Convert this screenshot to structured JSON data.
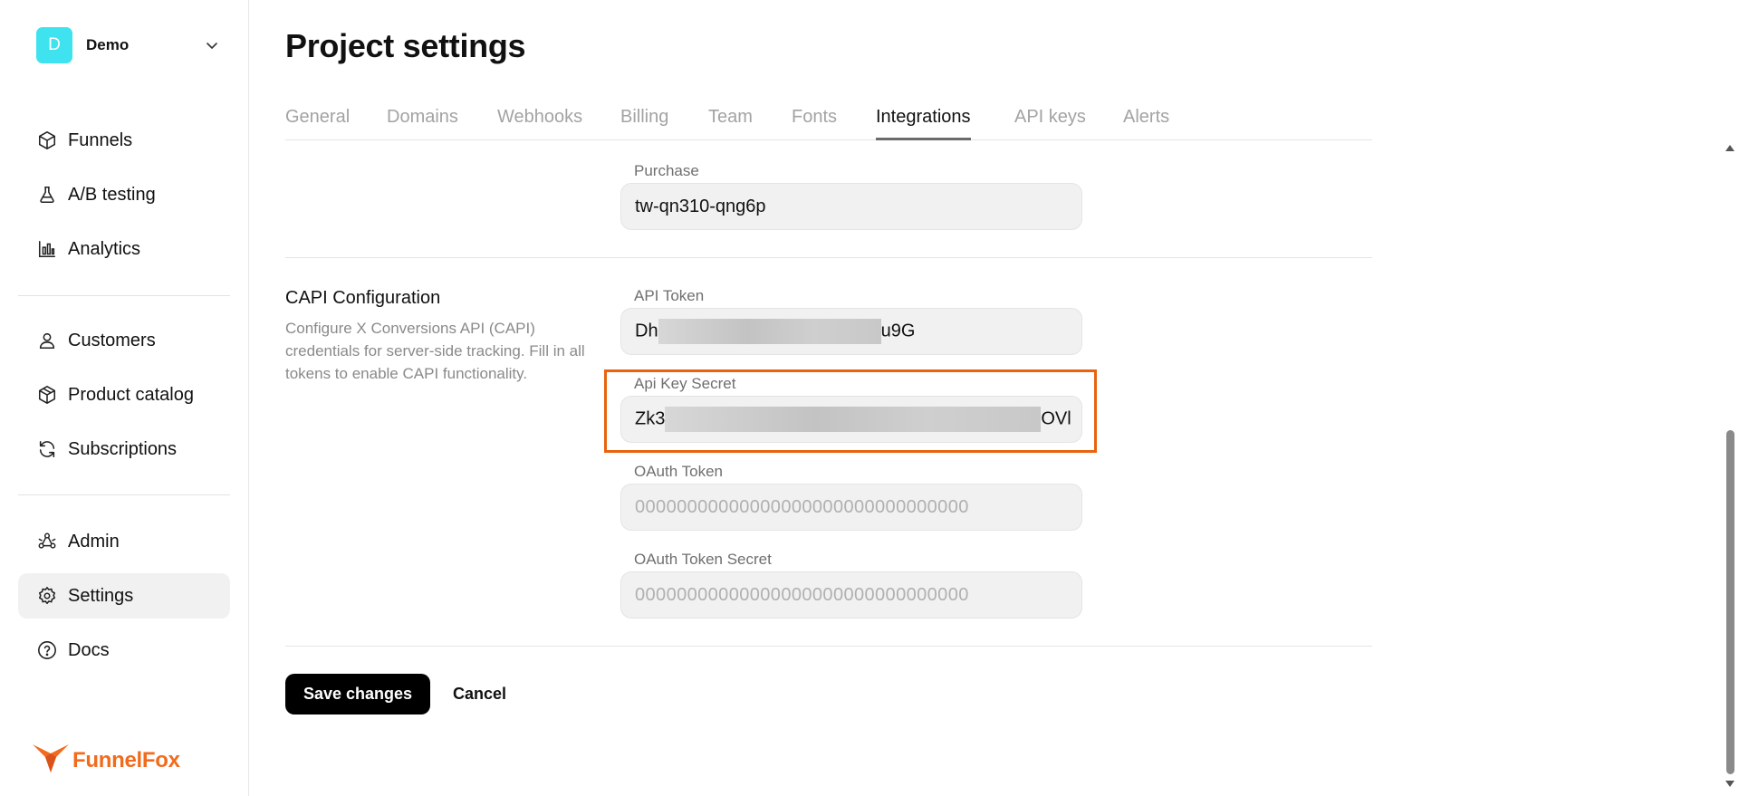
{
  "workspace": {
    "initial": "D",
    "name": "Demo",
    "avatar_color": "#3fe3f0"
  },
  "sidebar": {
    "items": [
      {
        "label": "Funnels",
        "icon": "cube-icon"
      },
      {
        "label": "A/B testing",
        "icon": "flask-icon"
      },
      {
        "label": "Analytics",
        "icon": "bar-chart-icon"
      },
      {
        "label": "Customers",
        "icon": "user-icon"
      },
      {
        "label": "Product catalog",
        "icon": "box-icon"
      },
      {
        "label": "Subscriptions",
        "icon": "refresh-icon"
      },
      {
        "label": "Admin",
        "icon": "admin-nodes-icon"
      },
      {
        "label": "Settings",
        "icon": "gear-icon",
        "active": true
      },
      {
        "label": "Docs",
        "icon": "help-circle-icon"
      }
    ]
  },
  "brand": {
    "name": "FunnelFox",
    "color": "#f26b1d"
  },
  "page": {
    "title": "Project settings"
  },
  "tabs": [
    "General",
    "Domains",
    "Webhooks",
    "Billing",
    "Team",
    "Fonts",
    "Integrations",
    "API keys",
    "Alerts"
  ],
  "active_tab": "Integrations",
  "fields": {
    "purchase": {
      "label": "Purchase",
      "value": "tw-qn310-qng6p"
    },
    "api_token": {
      "label": "API Token",
      "value_start": "Dh",
      "value_end": "u9G"
    },
    "api_key_secret": {
      "label": "Api Key Secret",
      "value_start": "Zk3",
      "value_end": "OVl"
    },
    "oauth_token": {
      "label": "OAuth Token",
      "placeholder": "00000000000000000000000000000000"
    },
    "oauth_token_secret": {
      "label": "OAuth Token Secret",
      "placeholder": "00000000000000000000000000000000"
    }
  },
  "capi": {
    "title": "CAPI Configuration",
    "description": "Configure X Conversions API (CAPI) credentials for server-side tracking. Fill in all tokens to enable CAPI functionality."
  },
  "actions": {
    "save_label": "Save changes",
    "cancel_label": "Cancel"
  },
  "colors": {
    "highlight": "#e8620f",
    "active_nav_bg": "#f1f1f1",
    "primary_button": "#000000"
  }
}
